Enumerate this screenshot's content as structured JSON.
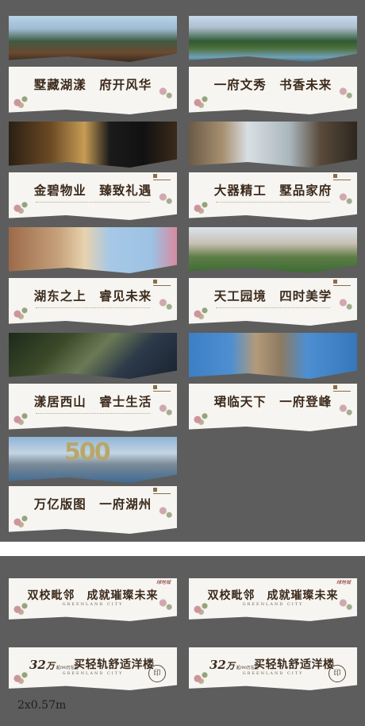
{
  "cards": [
    {
      "slogan": "墅藏湖漾　府开风华"
    },
    {
      "slogan": "一府文秀　书香未来"
    },
    {
      "slogan": "金碧物业　臻致礼遇"
    },
    {
      "slogan": "大器精工　墅品家府"
    },
    {
      "slogan": "湖东之上　睿见未来"
    },
    {
      "slogan": "天工园境　四时美学"
    },
    {
      "slogan": "漾居西山　睿士生活"
    },
    {
      "slogan": "珺临天下　一府登峰"
    },
    {
      "slogan": "万亿版图　一府湖州"
    }
  ],
  "bottom_cards": [
    {
      "slogan": "双校毗邻　成就璀璨未来",
      "en": "GREENLAND CITY",
      "corner": "绿地城"
    },
    {
      "slogan": "双校毗邻　成就璀璨未来",
      "en": "GREENLAND CITY",
      "corner": "绿地城"
    },
    {
      "price_num": "32",
      "price_unit": "万",
      "price_small": "起/90万左右",
      "slogan": "买轻轨舒适洋楼",
      "en": "GREENLAND CITY"
    },
    {
      "price_num": "32",
      "price_unit": "万",
      "price_small": "起/90万左右",
      "slogan": "买轻轨舒适洋楼",
      "en": "GREENLAND CITY"
    }
  ],
  "dimension_label": "2x0.57m",
  "colors": {
    "background": "#5d5d5d",
    "panel": "#f7f5f1",
    "text": "#3c2b1d"
  }
}
